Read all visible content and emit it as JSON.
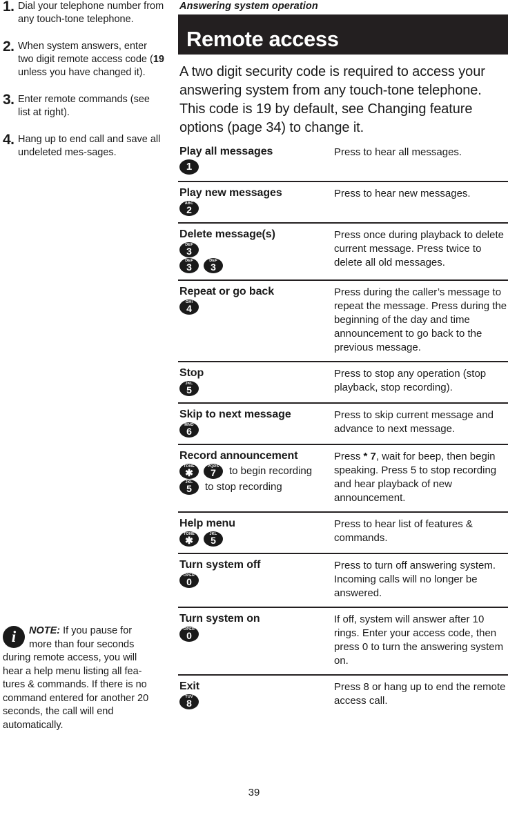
{
  "running_head": "Answering system operation",
  "section": {
    "title": "Remote access"
  },
  "intro": "A two digit security code is required to access your answering system from any touch-tone telephone.  This code is 19 by default, see Changing feature options (page 34) to change it.",
  "steps": [
    {
      "num": "1.",
      "text_before": "Dial your telephone number from any touch-tone telephone.",
      "bold": "",
      "text_after": ""
    },
    {
      "num": "2.",
      "text_before": "When system answers, enter two digit remote access code (",
      "bold": "19",
      "text_after": " unless you have changed it)."
    },
    {
      "num": "3.",
      "text_before": "Enter remote commands (see list at right).",
      "bold": "",
      "text_after": ""
    },
    {
      "num": "4.",
      "text_before": "Hang up to end call and save all undeleted mes-sages.",
      "bold": "",
      "text_after": ""
    }
  ],
  "note": {
    "icon": "info-icon",
    "label": "NOTE:",
    "text": " If you pause for more than four seconds during remote access, you will hear a help menu listing all fea-tures & commands. If there is no command entered for another 20 seconds, the call will end automatically."
  },
  "commands": [
    {
      "title": "Play all messages",
      "keys_lines": [
        {
          "keys": [
            {
              "letters": "",
              "digit": "1"
            }
          ],
          "caption": ""
        }
      ],
      "description_pre": "Press to hear all messages.",
      "description_bold": "",
      "description_post": ""
    },
    {
      "title": "Play new messages",
      "keys_lines": [
        {
          "keys": [
            {
              "letters": "ABC",
              "digit": "2"
            }
          ],
          "caption": ""
        }
      ],
      "description_pre": "Press to hear new messages.",
      "description_bold": "",
      "description_post": ""
    },
    {
      "title": "Delete message(s)",
      "keys_lines": [
        {
          "keys": [
            {
              "letters": "DEF",
              "digit": "3"
            }
          ],
          "caption": ""
        },
        {
          "keys": [
            {
              "letters": "DEF",
              "digit": "3"
            },
            {
              "letters": "DEF",
              "digit": "3"
            }
          ],
          "caption": ""
        }
      ],
      "description_pre": "Press once during playback to delete current message. Press twice to delete all old messages.",
      "description_bold": "",
      "description_post": ""
    },
    {
      "title": "Repeat or go back",
      "keys_lines": [
        {
          "keys": [
            {
              "letters": "GHI",
              "digit": "4"
            }
          ],
          "caption": ""
        }
      ],
      "description_pre": "Press during the caller’s message to repeat the message. Press during the beginning of the day and time announcement to go back to the previous message.",
      "description_bold": "",
      "description_post": ""
    },
    {
      "title": "Stop",
      "keys_lines": [
        {
          "keys": [
            {
              "letters": "JKL",
              "digit": "5"
            }
          ],
          "caption": ""
        }
      ],
      "description_pre": "Press to stop any operation (stop playback, stop recording).",
      "description_bold": "",
      "description_post": ""
    },
    {
      "title": "Skip to next message",
      "keys_lines": [
        {
          "keys": [
            {
              "letters": "MNO",
              "digit": "6"
            }
          ],
          "caption": ""
        }
      ],
      "description_pre": "Press to skip current message and advance to next message.",
      "description_bold": "",
      "description_post": ""
    },
    {
      "title": "Record announcement",
      "keys_lines": [
        {
          "keys": [
            {
              "letters": "TONE",
              "digit": "✱"
            },
            {
              "letters": "PQRS",
              "digit": "7"
            }
          ],
          "caption": "to begin recording"
        },
        {
          "keys": [
            {
              "letters": "JKL",
              "digit": "5"
            }
          ],
          "caption": "to stop recording"
        }
      ],
      "description_pre": "Press ",
      "description_bold": "* 7",
      "description_post": ", wait for beep, then begin speaking. Press 5 to stop recording and hear playback of new announcement."
    },
    {
      "title": "Help menu",
      "keys_lines": [
        {
          "keys": [
            {
              "letters": "TONE",
              "digit": "✱"
            },
            {
              "letters": "JKL",
              "digit": "5"
            }
          ],
          "caption": ""
        }
      ],
      "description_pre": "Press to hear list of features & commands.",
      "description_bold": "",
      "description_post": ""
    },
    {
      "title": "Turn system off",
      "keys_lines": [
        {
          "keys": [
            {
              "letters": "OPER",
              "digit": "0"
            }
          ],
          "caption": ""
        }
      ],
      "description_pre": "Press to turn off answering system. Incoming calls will no longer be answered.",
      "description_bold": "",
      "description_post": ""
    },
    {
      "title": "Turn system on",
      "keys_lines": [
        {
          "keys": [
            {
              "letters": "OPER",
              "digit": "0"
            }
          ],
          "caption": ""
        }
      ],
      "description_pre": "If off, system will answer after 10 rings. Enter your access code, then press 0 to turn the answering system on.",
      "description_bold": "",
      "description_post": ""
    },
    {
      "title": "Exit",
      "keys_lines": [
        {
          "keys": [
            {
              "letters": "TUV",
              "digit": "8"
            }
          ],
          "caption": ""
        }
      ],
      "description_pre": "Press 8 or hang up to end the remote access call.",
      "description_bold": "",
      "description_post": ""
    }
  ],
  "footer": {
    "page_number": "39"
  },
  "colors": {
    "banner_bg": "#231f20",
    "text": "#1a1a1a",
    "key_bg": "#1a1a1a"
  }
}
